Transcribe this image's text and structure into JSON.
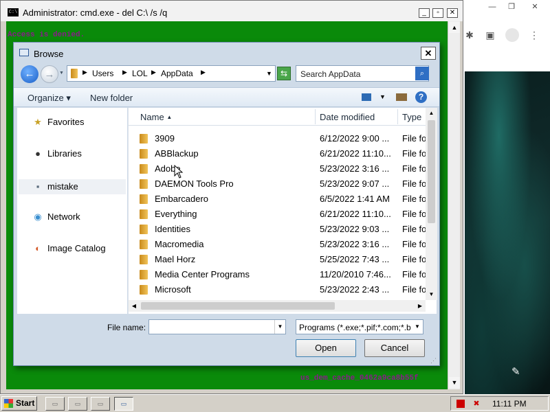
{
  "cmd": {
    "title": "Administrator: cmd.exe - del  C:\\ /s /q",
    "console_lines": [
      "Access is denied.",
      "us_dem_cache_0462a9ca8b55f"
    ],
    "min": "_",
    "max": "▫",
    "close": "✕"
  },
  "browser": {
    "min": "—",
    "max": "❐",
    "close": "✕",
    "edit_icon": "✎"
  },
  "dialog": {
    "title": "Browse",
    "close": "✕",
    "address": {
      "segments": [
        "Users",
        "LOL",
        "AppData"
      ],
      "separator": "▶"
    },
    "search_placeholder": "Search AppData",
    "toolbar": {
      "organize": "Organize ▾",
      "new_folder": "New folder",
      "help": "?"
    },
    "nav": [
      {
        "label": "Favorites",
        "icon": "star-icon"
      },
      {
        "label": "Libraries",
        "icon": "library-icon"
      },
      {
        "label": "mistake",
        "icon": "user-icon"
      },
      {
        "label": "Network",
        "icon": "network-icon"
      },
      {
        "label": "Image Catalog",
        "icon": "catalog-icon"
      }
    ],
    "columns": {
      "name": "Name",
      "sort_arrow": "▲",
      "date": "Date modified",
      "type": "Type"
    },
    "files": [
      {
        "name": "3909",
        "date": "6/12/2022 9:00 ...",
        "type": "File fo"
      },
      {
        "name": "ABBlackup",
        "date": "6/21/2022 11:10...",
        "type": "File fo"
      },
      {
        "name": "Adobe",
        "date": "5/23/2022 3:16 ...",
        "type": "File fo"
      },
      {
        "name": "DAEMON Tools Pro",
        "date": "5/23/2022 9:07 ...",
        "type": "File fo"
      },
      {
        "name": "Embarcadero",
        "date": "6/5/2022 1:41 AM",
        "type": "File fo"
      },
      {
        "name": "Everything",
        "date": "6/21/2022 11:10...",
        "type": "File fo"
      },
      {
        "name": "Identities",
        "date": "5/23/2022 9:03 ...",
        "type": "File fo"
      },
      {
        "name": "Macromedia",
        "date": "5/23/2022 3:16 ...",
        "type": "File fo"
      },
      {
        "name": "Mael Horz",
        "date": "5/25/2022 7:43 ...",
        "type": "File fo"
      },
      {
        "name": "Media Center Programs",
        "date": "11/20/2010 7:46...",
        "type": "File fo"
      },
      {
        "name": "Microsoft",
        "date": "5/23/2022 2:43 ...",
        "type": "File fo"
      }
    ],
    "file_name_label": "File name:",
    "file_name_value": "",
    "file_type": "Programs (*.exe;*.pif;*.com;*.ba",
    "open": "Open",
    "cancel": "Cancel"
  },
  "taskbar": {
    "start": "Start",
    "clock": "11:11 PM"
  }
}
